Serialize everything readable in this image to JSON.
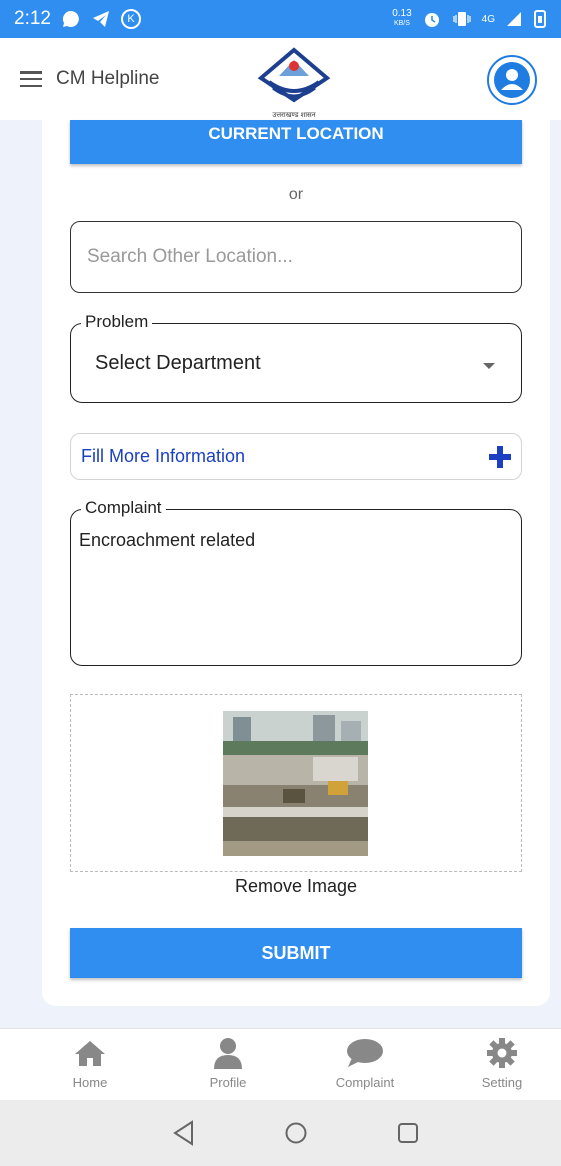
{
  "status_bar": {
    "time": "2:12",
    "speed_value": "0.13",
    "speed_unit": "KB/S",
    "network": "4G"
  },
  "header": {
    "title": "CM Helpline",
    "logo_caption": "उत्तराखण्ड शासन"
  },
  "form": {
    "current_location_label": "CURRENT LOCATION",
    "or_text": "or",
    "search_placeholder": "Search Other Location...",
    "problem_legend": "Problem",
    "problem_value": "Select Department",
    "more_info_label": "Fill More Information",
    "complaint_legend": "Complaint",
    "complaint_value": "Encroachment related",
    "remove_image_label": "Remove Image",
    "submit_label": "SUBMIT"
  },
  "tabs": [
    {
      "label": "Home",
      "icon": "home-icon"
    },
    {
      "label": "Profile",
      "icon": "person-icon"
    },
    {
      "label": "Complaint",
      "icon": "chat-bubble-icon"
    },
    {
      "label": "Setting",
      "icon": "gear-icon"
    }
  ],
  "colors": {
    "accent": "#2f8ef0",
    "link": "#1a3fc0"
  }
}
